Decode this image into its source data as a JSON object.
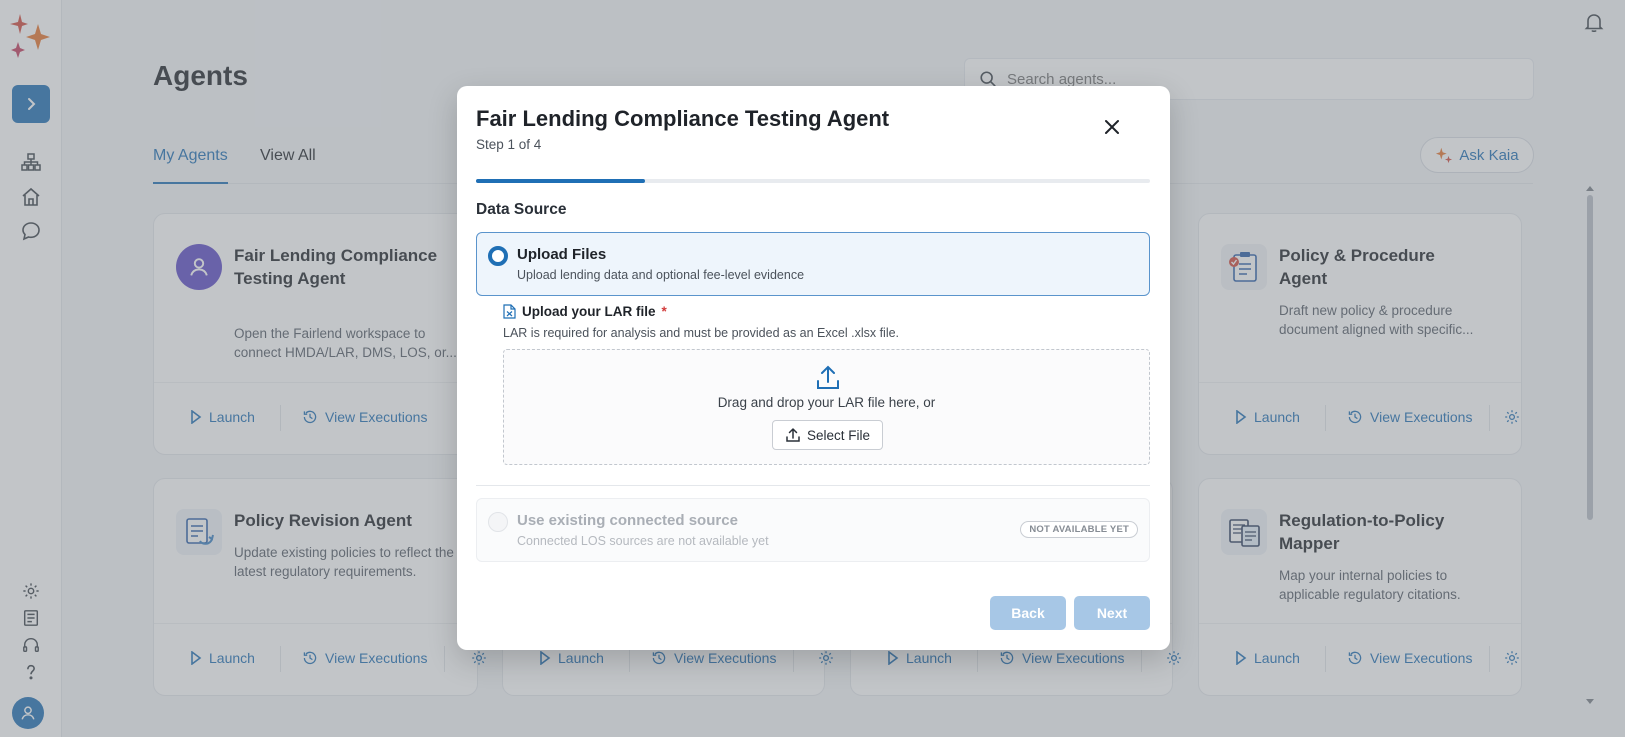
{
  "sidebar": {
    "items": [
      "sitemap-icon",
      "home-icon",
      "chat-icon",
      "gear-icon",
      "list-icon",
      "headset-icon",
      "help-icon",
      "user-icon"
    ]
  },
  "header": {
    "title": "Agents",
    "search_placeholder": "Search agents..."
  },
  "tabs": [
    {
      "label": "My Agents",
      "active": true
    },
    {
      "label": "View All",
      "active": false
    }
  ],
  "ask_kaia_label": "Ask Kaia",
  "cards": [
    {
      "title": "Fair Lending Compliance Testing Agent",
      "desc": "Open the Fairlend workspace to connect HMDA/LAR, DMS, LOS, or...",
      "launch": "Launch",
      "view": "View Executions"
    },
    {
      "title": "Policy & Procedure Agent",
      "desc": "Draft new policy & procedure document aligned with specific...",
      "launch": "Launch",
      "view": "View Executions"
    },
    {
      "title": "Policy Revision Agent",
      "desc": "Update existing policies to reflect the latest regulatory requirements.",
      "launch": "Launch",
      "view": "View Executions"
    },
    {
      "title": "Regulation-to-Policy Mapper",
      "desc": "Map your internal policies to applicable regulatory citations.",
      "launch": "Launch",
      "view": "View Executions"
    }
  ],
  "hidden_card_actions": {
    "launch": "Launch",
    "view": "View Executions"
  },
  "modal": {
    "title": "Fair Lending Compliance Testing Agent",
    "step": "Step 1 of 4",
    "progress_fraction": 0.25,
    "section_label": "Data Source",
    "option_upload": {
      "title": "Upload Files",
      "subtitle": "Upload lending data and optional fee-level evidence",
      "selected": true
    },
    "lar": {
      "label": "Upload your LAR file",
      "required_marker": "*",
      "help": "LAR is required for analysis and must be provided as an Excel .xlsx file.",
      "drop_text": "Drag and drop your LAR file here, or",
      "select_label": "Select File"
    },
    "option_existing": {
      "title": "Use existing connected source",
      "subtitle": "Connected LOS sources are not available yet",
      "badge": "NOT AVAILABLE YET",
      "selected": false
    },
    "back_label": "Back",
    "next_label": "Next"
  },
  "colors": {
    "accent": "#1f6fb5",
    "disabled_button": "#a7c7e6",
    "required": "#d23a3a"
  }
}
